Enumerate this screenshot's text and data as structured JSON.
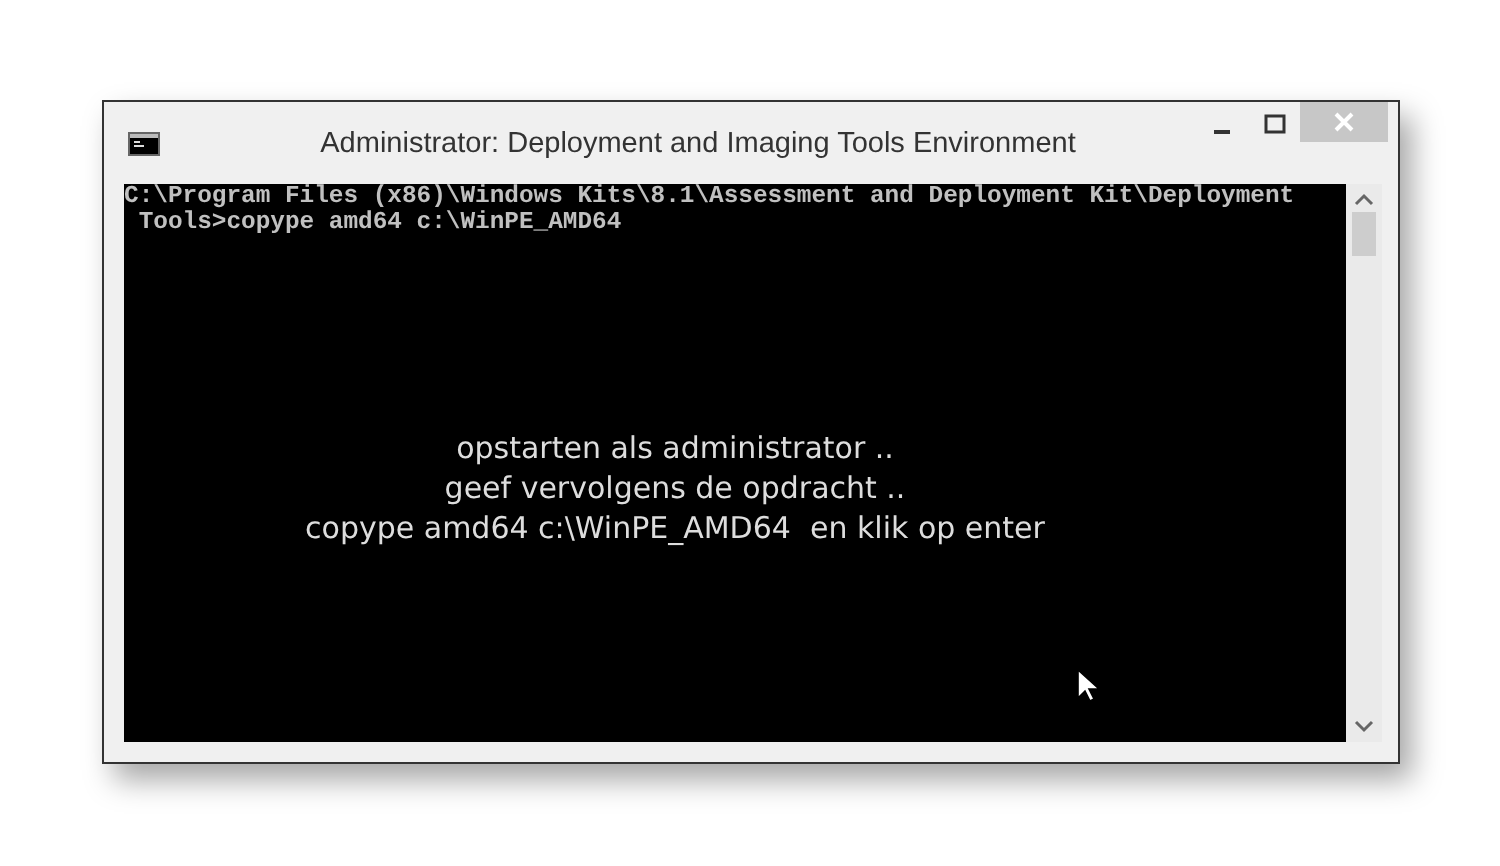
{
  "window": {
    "title": "Administrator: Deployment and Imaging Tools Environment"
  },
  "console": {
    "lines": [
      "C:\\Program Files (x86)\\Windows Kits\\8.1\\Assessment and Deployment Kit\\Deployment",
      " Tools>copype amd64 c:\\WinPE_AMD64"
    ]
  },
  "caption": {
    "lines": [
      "opstarten als administrator ..",
      "geef vervolgens de opdracht ..",
      "copype amd64 c:\\WinPE_AMD64  en klik op enter"
    ]
  }
}
